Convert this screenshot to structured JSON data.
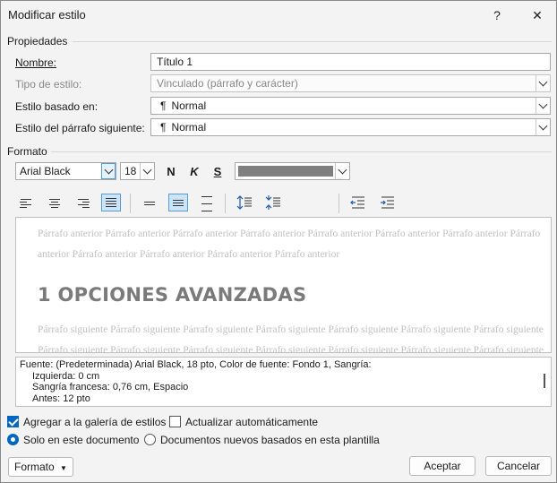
{
  "window": {
    "title": "Modificar estilo",
    "help_glyph": "?",
    "close_glyph": "✕"
  },
  "properties": {
    "section_title": "Propiedades",
    "name_label": "Nombre:",
    "name_value": "Título 1",
    "type_label": "Tipo de estilo:",
    "type_value": "Vinculado (párrafo y carácter)",
    "based_on_label": "Estilo basado en:",
    "based_on_value": "Normal",
    "next_label": "Estilo del párrafo siguiente:",
    "next_value": "Normal",
    "para_mark": "¶"
  },
  "format": {
    "section_title": "Formato",
    "font": "Arial Black",
    "size": "18",
    "bold": "N",
    "italic": "K",
    "underline": "S",
    "color_swatch": "#7f7f7f"
  },
  "preview": {
    "prev_line1": "Párrafo anterior Párrafo anterior Párrafo anterior Párrafo anterior Párrafo anterior Párrafo anterior Párrafo anterior Párrafo",
    "prev_line2": "anterior Párrafo anterior Párrafo anterior Párrafo anterior Párrafo anterior",
    "heading": "1  OPCIONES AVANZADAS",
    "next_line1": "Párrafo siguiente Párrafo siguiente Párrafo siguiente Párrafo siguiente Párrafo siguiente Párrafo siguiente Párrafo siguiente",
    "next_line2": "Párrafo siguiente Párrafo siguiente Párrafo siguiente Párrafo siguiente Párrafo siguiente Párrafo siguiente Párrafo siguiente"
  },
  "description": {
    "line1": "Fuente: (Predeterminada) Arial Black, 18 pto, Color de fuente: Fondo 1, Sangría:",
    "line2": "Izquierda:  0 cm",
    "line3": "Sangría francesa:  0,76 cm, Espacio",
    "line4": "Antes:  12 pto"
  },
  "options": {
    "add_gallery": "Agregar a la galería de estilos",
    "auto_update": "Actualizar automáticamente",
    "only_doc": "Solo en este documento",
    "new_docs": "Documentos nuevos basados en esta plantilla"
  },
  "buttons": {
    "format": "Formato",
    "accept": "Aceptar",
    "cancel": "Cancelar"
  }
}
